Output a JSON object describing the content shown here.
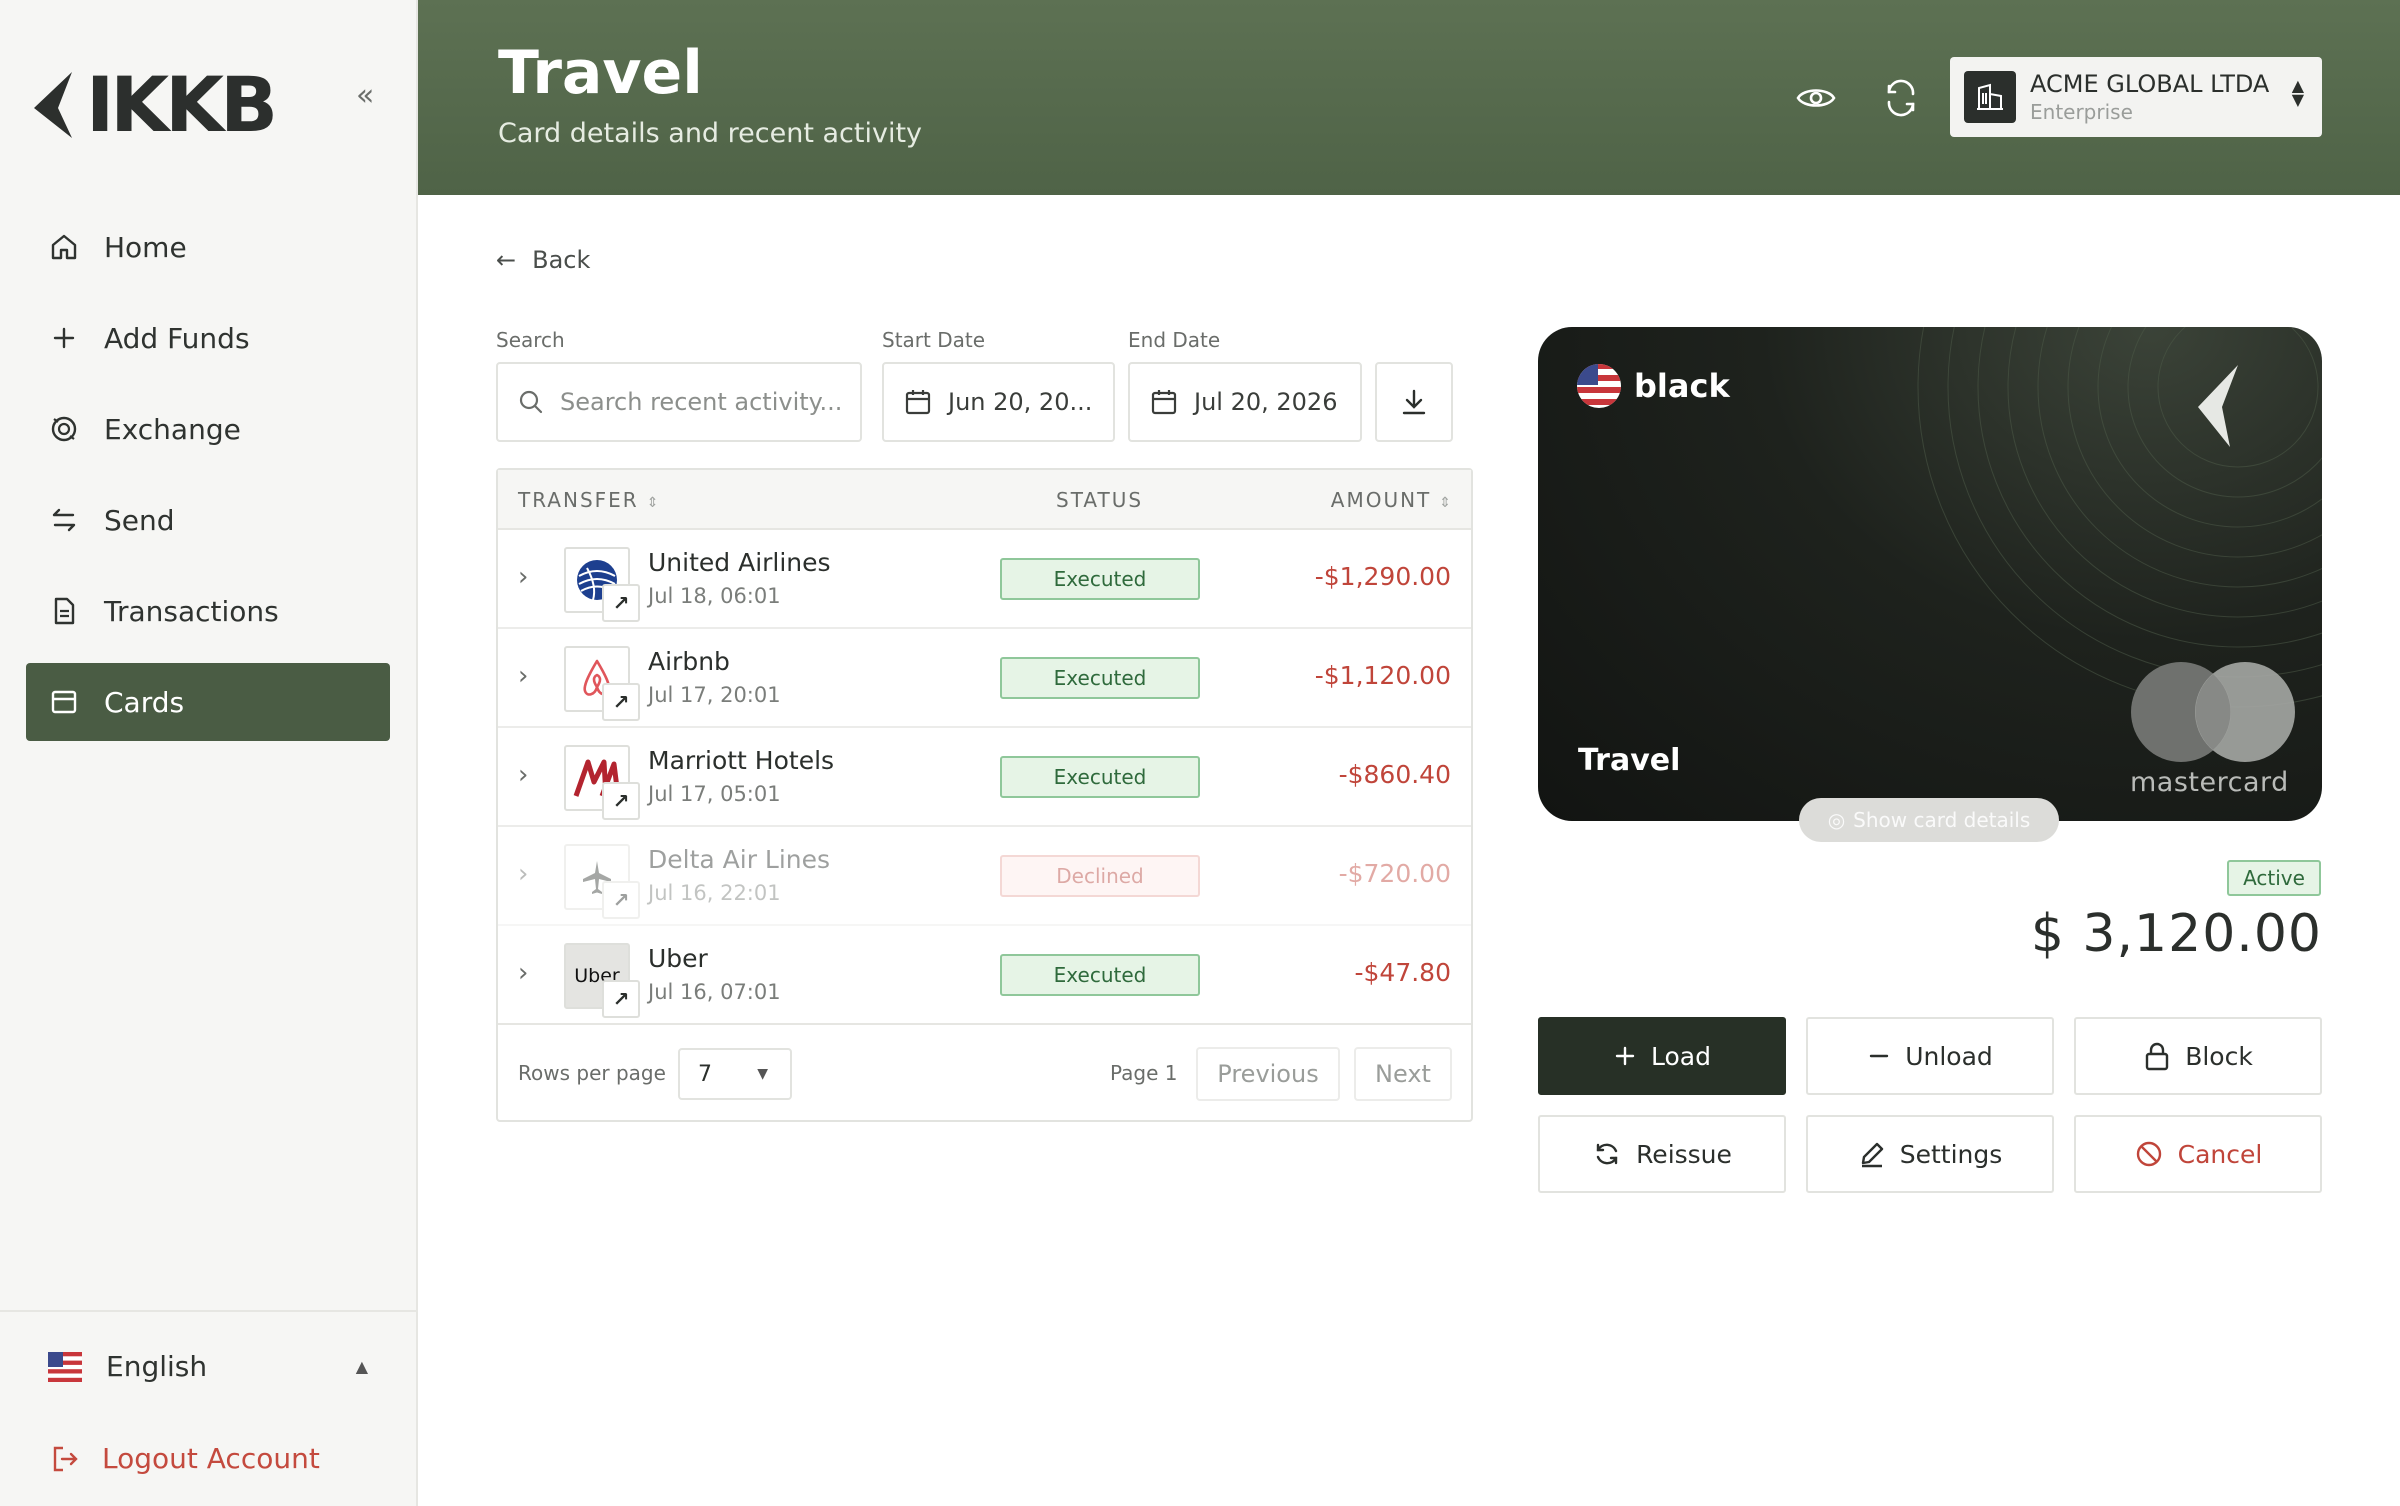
{
  "sidebar": {
    "brand": "IKKB",
    "nav": [
      {
        "label": "Home",
        "icon": "home-icon"
      },
      {
        "label": "Add Funds",
        "icon": "plus-icon"
      },
      {
        "label": "Exchange",
        "icon": "exchange-icon"
      },
      {
        "label": "Send",
        "icon": "send-arrows-icon"
      },
      {
        "label": "Transactions",
        "icon": "document-icon"
      },
      {
        "label": "Cards",
        "icon": "card-icon",
        "active": true
      }
    ],
    "language": "English",
    "logout": "Logout Account"
  },
  "header": {
    "title": "Travel",
    "subtitle": "Card details and recent activity",
    "account_name": "ACME GLOBAL LTDA",
    "account_type": "Enterprise"
  },
  "main": {
    "back": "Back",
    "search_label": "Search",
    "search_placeholder": "Search recent activity...",
    "start_label": "Start Date",
    "start_value": "Jun 20, 20...",
    "end_label": "End Date",
    "end_value": "Jul 20, 2026"
  },
  "table": {
    "columns": {
      "transfer": "TRANSFER",
      "status": "STATUS",
      "amount": "AMOUNT"
    },
    "rows": [
      {
        "merchant": "United Airlines",
        "date": "Jul 18, 06:01",
        "status": "Executed",
        "amount": "-$1,290.00"
      },
      {
        "merchant": "Airbnb",
        "date": "Jul 17, 20:01",
        "status": "Executed",
        "amount": "-$1,120.00"
      },
      {
        "merchant": "Marriott Hotels",
        "date": "Jul 17, 05:01",
        "status": "Executed",
        "amount": "-$860.40"
      },
      {
        "merchant": "Delta Air Lines",
        "date": "Jul 16, 22:01",
        "status": "Declined",
        "amount": "-$720.00"
      },
      {
        "merchant": "Uber",
        "date": "Jul 16, 07:01",
        "status": "Executed",
        "amount": "-$47.80",
        "logo_text": "Uber"
      }
    ],
    "rows_per_page_label": "Rows per page",
    "rows_per_page": "7",
    "page_label": "Page 1",
    "previous": "Previous",
    "next": "Next"
  },
  "card": {
    "tier": "black",
    "name": "Travel",
    "network": "mastercard",
    "show_details": "Show card details",
    "status": "Active",
    "balance": "$ 3,120.00"
  },
  "actions": {
    "load": "Load",
    "unload": "Unload",
    "block": "Block",
    "reissue": "Reissue",
    "settings": "Settings",
    "cancel": "Cancel"
  },
  "colors": {
    "accent": "#4a5c44",
    "header": "#586c4e",
    "danger": "#c0453a",
    "success": "#2f6a3c"
  }
}
